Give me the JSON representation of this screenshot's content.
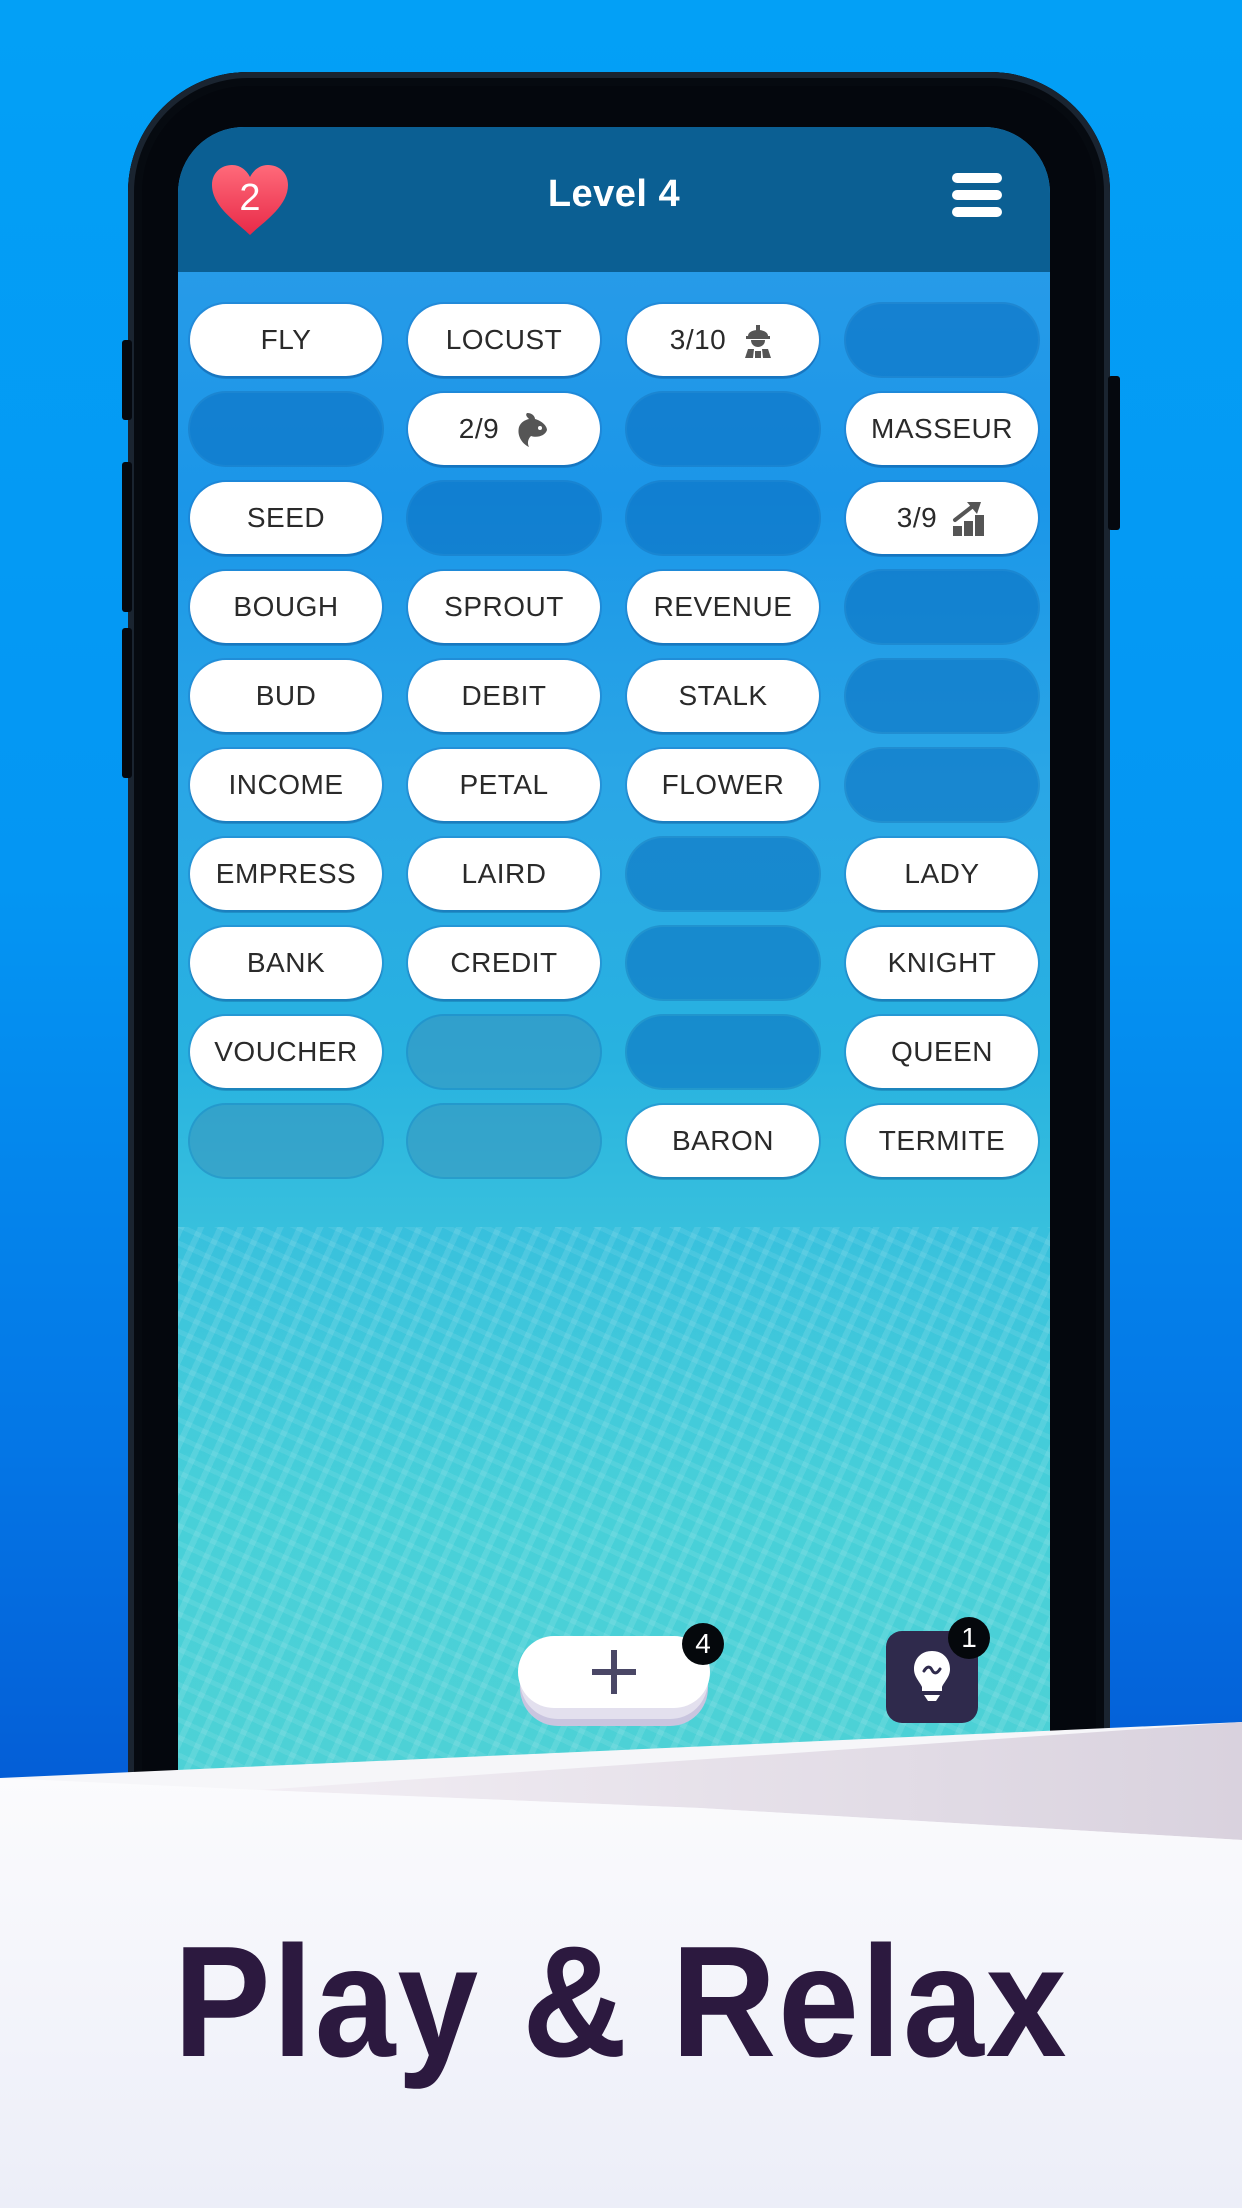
{
  "header": {
    "lives": "2",
    "level_title": "Level 4",
    "menu_icon": "hamburger-menu-icon",
    "lives_icon": "heart-icon"
  },
  "board": {
    "rows": [
      [
        {
          "type": "word",
          "text": "FLY"
        },
        {
          "type": "word",
          "text": "LOCUST"
        },
        {
          "type": "category",
          "text": "3/10",
          "icon": "worker-icon"
        },
        {
          "type": "empty"
        }
      ],
      [
        {
          "type": "empty"
        },
        {
          "type": "category",
          "text": "2/9",
          "icon": "fish-icon"
        },
        {
          "type": "empty"
        },
        {
          "type": "word",
          "text": "MASSEUR"
        }
      ],
      [
        {
          "type": "word",
          "text": "SEED"
        },
        {
          "type": "empty"
        },
        {
          "type": "empty"
        },
        {
          "type": "category",
          "text": "3/9",
          "icon": "growth-chart-icon"
        }
      ],
      [
        {
          "type": "word",
          "text": "BOUGH"
        },
        {
          "type": "word",
          "text": "SPROUT"
        },
        {
          "type": "word",
          "text": "REVENUE"
        },
        {
          "type": "empty"
        }
      ],
      [
        {
          "type": "word",
          "text": "BUD"
        },
        {
          "type": "word",
          "text": "DEBIT"
        },
        {
          "type": "word",
          "text": "STALK"
        },
        {
          "type": "empty"
        }
      ],
      [
        {
          "type": "word",
          "text": "INCOME"
        },
        {
          "type": "word",
          "text": "PETAL"
        },
        {
          "type": "word",
          "text": "FLOWER"
        },
        {
          "type": "empty"
        }
      ],
      [
        {
          "type": "word",
          "text": "EMPRESS"
        },
        {
          "type": "word",
          "text": "LAIRD"
        },
        {
          "type": "empty"
        },
        {
          "type": "word",
          "text": "LADY"
        }
      ],
      [
        {
          "type": "word",
          "text": "BANK"
        },
        {
          "type": "word",
          "text": "CREDIT"
        },
        {
          "type": "empty"
        },
        {
          "type": "word",
          "text": "KNIGHT"
        }
      ],
      [
        {
          "type": "word",
          "text": "VOUCHER"
        },
        {
          "type": "empty"
        },
        {
          "type": "empty"
        },
        {
          "type": "word",
          "text": "QUEEN"
        }
      ],
      [
        {
          "type": "empty"
        },
        {
          "type": "empty"
        },
        {
          "type": "word",
          "text": "BARON"
        },
        {
          "type": "word",
          "text": "TERMITE"
        }
      ]
    ]
  },
  "controls": {
    "add_cards": {
      "icon": "plus-icon",
      "badge": "4"
    },
    "hint": {
      "icon": "lightbulb-icon",
      "badge": "1"
    }
  },
  "promo": {
    "tagline": "Play & Relax"
  },
  "colors": {
    "header_bg": "#0b5f93",
    "heart": "#f0435a",
    "hint_bg": "#2f2a4c",
    "tagline": "#2c193f",
    "page_bg": "#0496f3"
  }
}
